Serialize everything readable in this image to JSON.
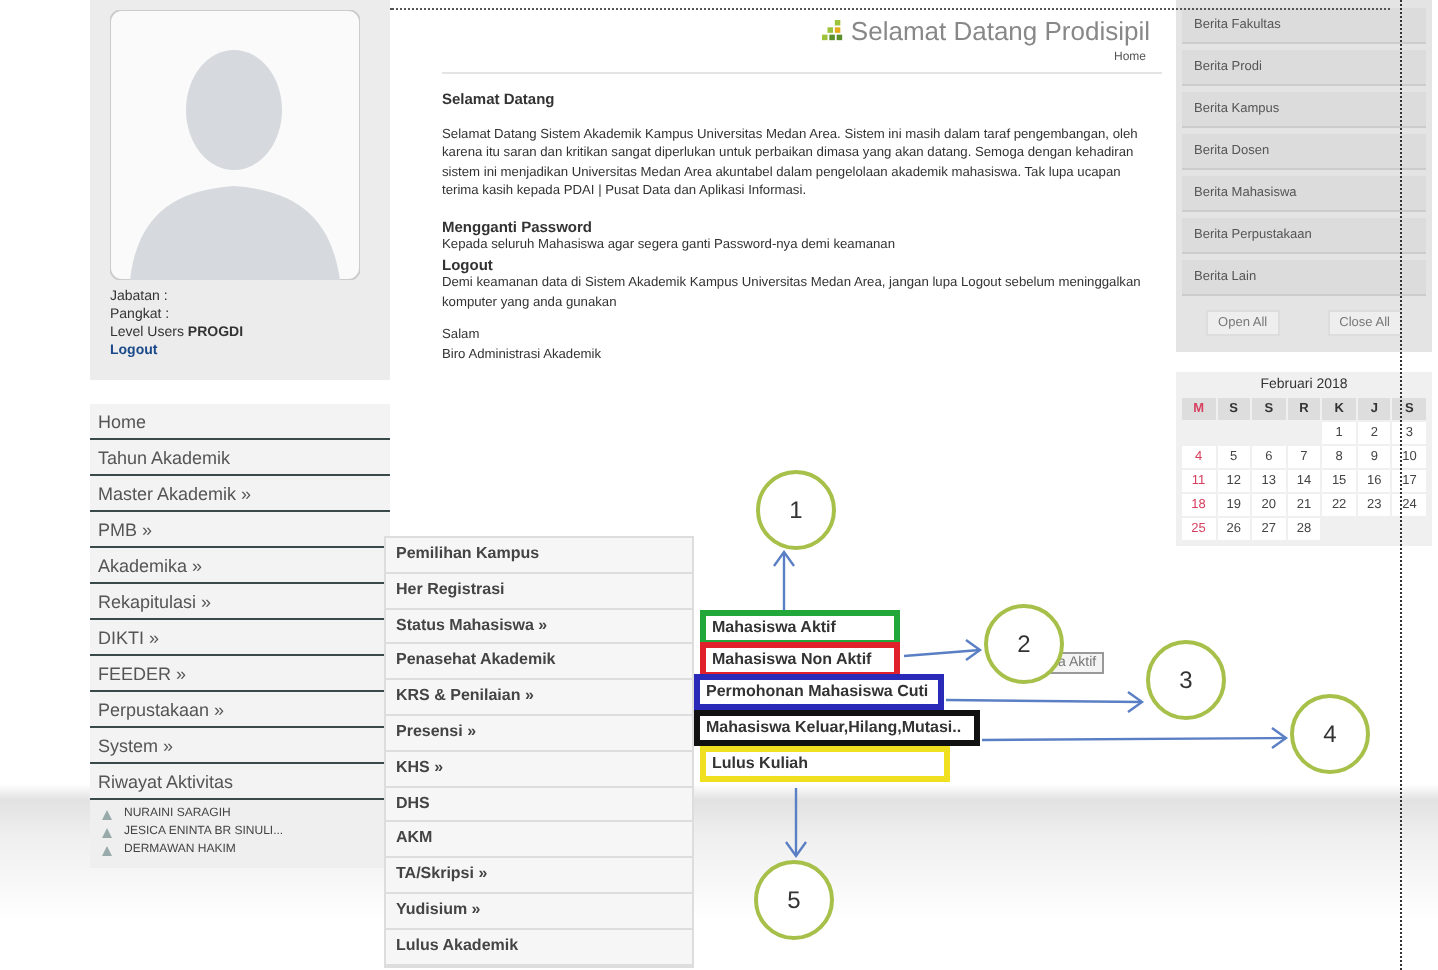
{
  "profile": {
    "info": [
      "Jabatan  :",
      "Pangkat  :",
      "Level Users **PROGDI**"
    ],
    "logout": "Logout"
  },
  "nav": [
    "Home",
    "Tahun Akademik",
    "Master Akademik »",
    "PMB »",
    "Akademika »",
    "Rekapitulasi »",
    "DIKTI »",
    "FEEDER »",
    "Perpustakaan »",
    "System »",
    "Riwayat Aktivitas"
  ],
  "history": [
    "NURAINI SARAGIH",
    "JESICA ENINTA BR SINULI...",
    "DERMAWAN HAKIM"
  ],
  "submenu": [
    "Pemilihan Kampus",
    "Her Registrasi",
    "Status Mahasiswa »",
    "Penasehat Akademik",
    "KRS & Penilaian »",
    "Presensi »",
    "KHS »",
    "DHS",
    "AKM",
    "TA/Skripsi »",
    "Yudisium »",
    "Lulus Akademik"
  ],
  "header": {
    "title": "Selamat Datang Prodisipil",
    "breadcrumb": "Home"
  },
  "welcome": {
    "heading": "Selamat Datang",
    "body": "Selamat Datang Sistem Akademik Kampus Universitas Medan Area. Sistem ini masih dalam taraf pengembangan, oleh karena itu saran dan kritikan sangat diperlukan untuk perbaikan dimasa yang akan datang. Semoga dengan kehadiran sistem ini menjadikan Universitas Medan Area akuntabel dalam pengelolaan akademik mahasiswa. Tak lupa ucapan terima kasih kepada PDAI | Pusat Data dan Aplikasi Informasi.",
    "sections": [
      {
        "heading": "Mengganti Password",
        "text": "Kepada seluruh Mahasiswa agar segera ganti Password-nya demi keamanan"
      },
      {
        "heading": "Logout",
        "text": "Demi keamanan data di Sistem Akademik Kampus Universitas Medan Area, jangan lupa Logout sebelum meninggalkan komputer yang anda gunakan"
      }
    ],
    "closing": [
      "Salam",
      "Biro Administrasi Akademik"
    ]
  },
  "news": [
    "Berita Fakultas",
    "Berita Prodi",
    "Berita Kampus",
    "Berita Dosen",
    "Berita Mahasiswa",
    "Berita Perpustakaan",
    "Berita Lain"
  ],
  "news_controls": [
    "Open All",
    "Close All"
  ],
  "calendar": {
    "title": "Februari 2018",
    "weekdays": [
      "M",
      "S",
      "S",
      "R",
      "K",
      "J",
      "S"
    ],
    "weeks": [
      [
        "1",
        "2",
        "3"
      ],
      [
        "4",
        "5",
        "6",
        "7",
        "8",
        "9",
        "10"
      ],
      [
        "11",
        "12",
        "13",
        "14",
        "15",
        "16",
        "17"
      ],
      [
        "18",
        "19",
        "20",
        "21",
        "22",
        "23",
        "24"
      ],
      [
        "25",
        "26",
        "27",
        "28"
      ]
    ]
  },
  "annotations": {
    "items": [
      {
        "label": "Mahasiswa Aktif",
        "color": "#22a83a"
      },
      {
        "label": "Mahasiswa Non Aktif",
        "color": "#e0202a"
      },
      {
        "label": "Permohonan Mahasiswa Cuti",
        "color": "#2a2ab8"
      },
      {
        "label": "Mahasiswa Keluar,Hilang,Mutasi..",
        "color": "#111111"
      },
      {
        "label": "Lulus Kuliah",
        "color": "#f0e020"
      }
    ],
    "tooltip": "a Aktif",
    "markers": [
      "1",
      "2",
      "3",
      "4",
      "5"
    ]
  }
}
